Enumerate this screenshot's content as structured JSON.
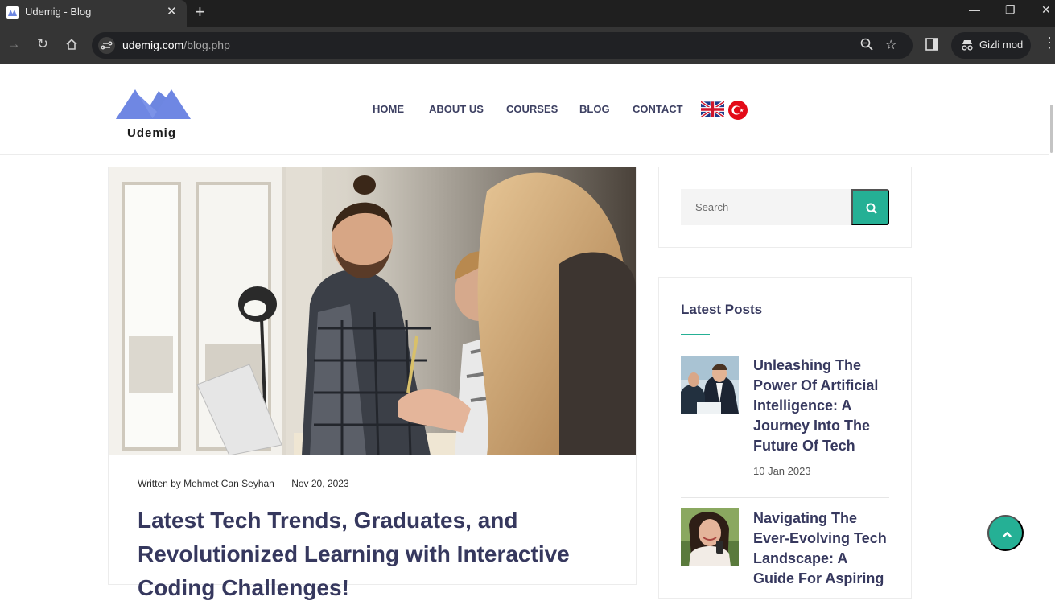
{
  "browser": {
    "tab_title": "Udemig - Blog",
    "url_domain": "udemig.com",
    "url_path": "/blog.php",
    "incognito_label": "Gizli mod"
  },
  "site": {
    "logo_text": "Udemig",
    "nav": [
      "HOME",
      "ABOUT US",
      "COURSES",
      "BLOG",
      "CONTACT"
    ],
    "flags": [
      "uk-flag-icon",
      "turkey-flag-icon"
    ]
  },
  "post": {
    "author": "Written by Mehmet Can Seyhan",
    "date": "Nov 20, 2023",
    "title": "Latest Tech Trends, Graduates, and Revolutionized Learning with Interactive Coding Challenges!"
  },
  "sidebar": {
    "search_placeholder": "Search",
    "latest_title": "Latest Posts",
    "latest_posts": [
      {
        "title": "Unleashing The Power Of Artificial Intelligence: A Journey Into The Future Of Tech",
        "date": "10 Jan 2023"
      },
      {
        "title": "Navigating The Ever-Evolving Tech Landscape: A Guide For Aspiring",
        "date": ""
      }
    ]
  },
  "colors": {
    "accent": "#25b095",
    "heading": "#36385e",
    "logo": "#6d86e0"
  }
}
